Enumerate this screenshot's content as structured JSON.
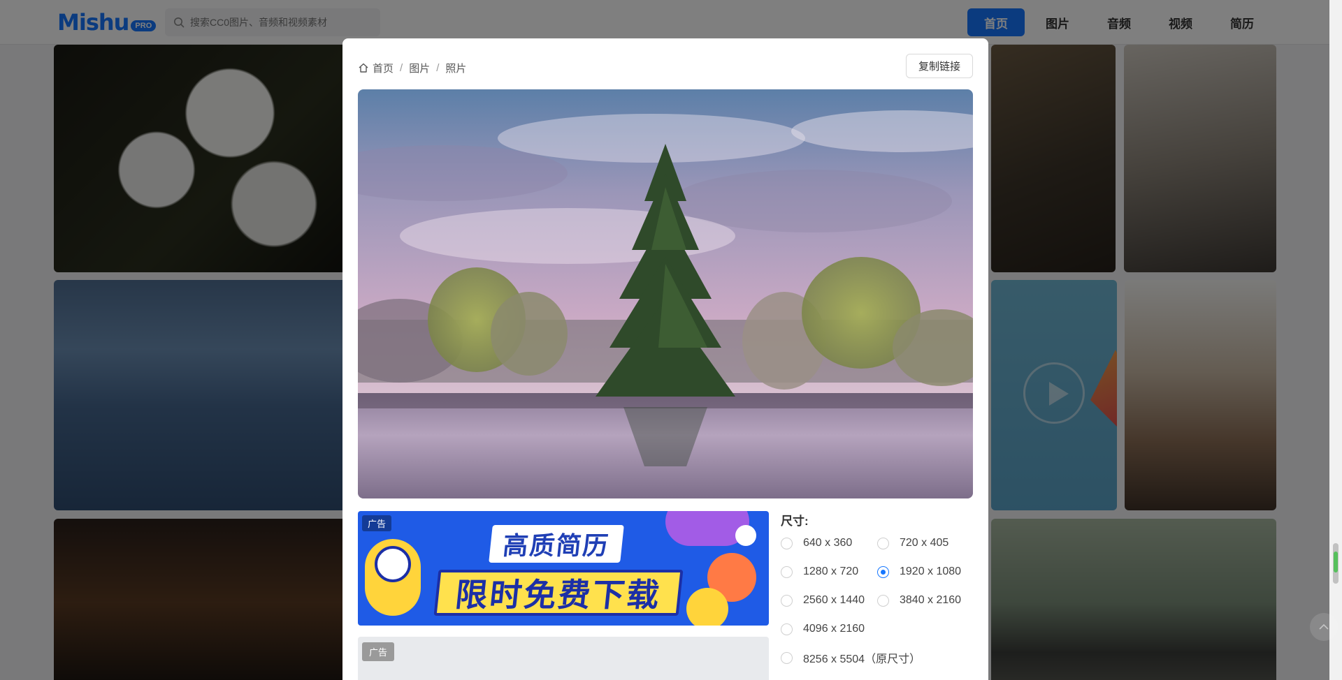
{
  "header": {
    "logo_text": "Mishu",
    "logo_badge": "PRO",
    "search_placeholder": "搜索CC0图片、音频和视频素材",
    "nav": [
      "首页",
      "图片",
      "音频",
      "视频",
      "简历"
    ],
    "active_nav": 0
  },
  "breadcrumb": [
    "首页",
    "图片",
    "照片"
  ],
  "modal": {
    "copy_link_label": "复制链接"
  },
  "ads": {
    "tag": "广告",
    "banner_line1": "高质简历",
    "banner_line2": "限时免费下载"
  },
  "sizes": {
    "title": "尺寸:",
    "selected_index": 3,
    "options": [
      "640 x 360",
      "720 x 405",
      "1280 x 720",
      "1920 x 1080",
      "2560 x 1440",
      "3840 x 2160",
      "4096 x 2160",
      "8256 x 5504（原尺寸）"
    ]
  },
  "colors": {
    "brand": "#1677ff",
    "overlay": "rgba(0,0,0,0.5)"
  }
}
